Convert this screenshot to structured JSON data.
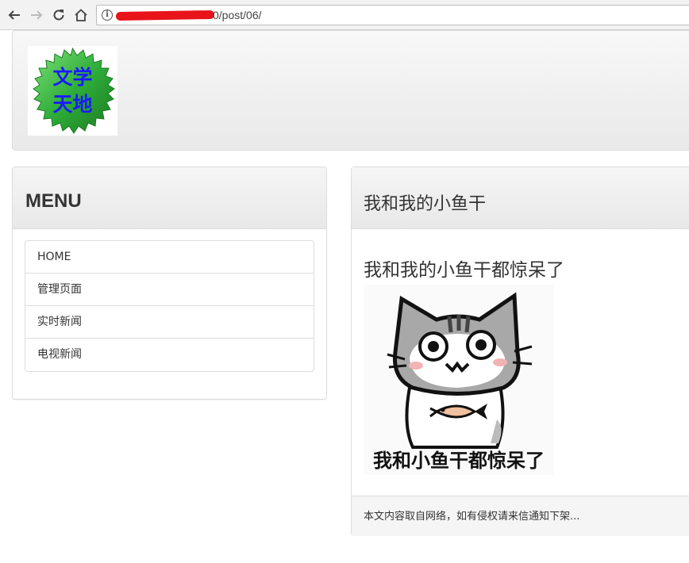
{
  "browser": {
    "url_path": "0/post/06/",
    "info_glyph": "i"
  },
  "header": {
    "logo": {
      "line1": "文学",
      "line2": "天地",
      "colors": {
        "badge_green": "#2fae3a",
        "text_blue": "#1a1aff"
      }
    }
  },
  "menu": {
    "title": "MENU",
    "items": [
      {
        "label": "HOME"
      },
      {
        "label": "管理页面"
      },
      {
        "label": "实时新闻"
      },
      {
        "label": "电视新闻"
      }
    ]
  },
  "post": {
    "title": "我和我的小鱼干",
    "subtitle": "我和我的小鱼干都惊呆了",
    "image": {
      "caption": "我和小鱼干都惊呆了",
      "subject": "cat-with-fish"
    },
    "footer": "本文内容取自网络，如有侵权请来信通知下架..."
  }
}
